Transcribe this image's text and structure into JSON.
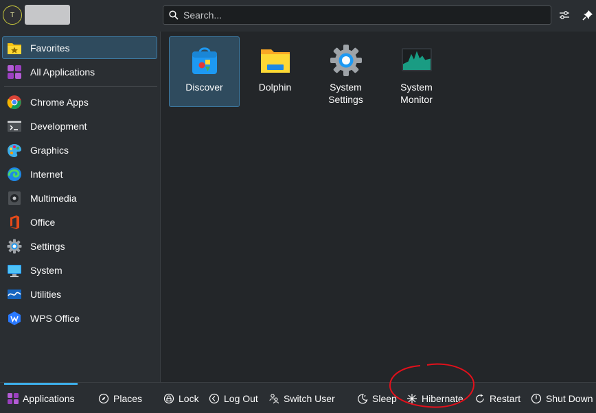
{
  "header": {
    "avatar_initial": "T",
    "search_placeholder": "Search..."
  },
  "sidebar": {
    "items": [
      {
        "label": "Favorites",
        "icon": "favorites-folder-icon"
      },
      {
        "label": "All Applications",
        "icon": "all-applications-icon"
      },
      {
        "label": "Chrome Apps",
        "icon": "chrome-icon"
      },
      {
        "label": "Development",
        "icon": "development-icon"
      },
      {
        "label": "Graphics",
        "icon": "graphics-icon"
      },
      {
        "label": "Internet",
        "icon": "internet-icon"
      },
      {
        "label": "Multimedia",
        "icon": "multimedia-icon"
      },
      {
        "label": "Office",
        "icon": "office-icon"
      },
      {
        "label": "Settings",
        "icon": "settings-icon"
      },
      {
        "label": "System",
        "icon": "system-icon"
      },
      {
        "label": "Utilities",
        "icon": "utilities-icon"
      },
      {
        "label": "WPS Office",
        "icon": "wps-office-icon"
      }
    ]
  },
  "favorites": [
    {
      "label": "Discover",
      "icon": "discover-icon"
    },
    {
      "label": "Dolphin",
      "icon": "dolphin-icon"
    },
    {
      "label": "System Settings",
      "icon": "system-settings-icon"
    },
    {
      "label": "System Monitor",
      "icon": "system-monitor-icon"
    }
  ],
  "footer": {
    "applications": "Applications",
    "places": "Places",
    "lock": "Lock",
    "logout": "Log Out",
    "switch_user": "Switch User",
    "sleep": "Sleep",
    "hibernate": "Hibernate",
    "restart": "Restart",
    "shutdown": "Shut Down"
  },
  "colors": {
    "accent": "#3daee9",
    "highlight": "#2f4b5e",
    "annotation": "#e3101b"
  }
}
